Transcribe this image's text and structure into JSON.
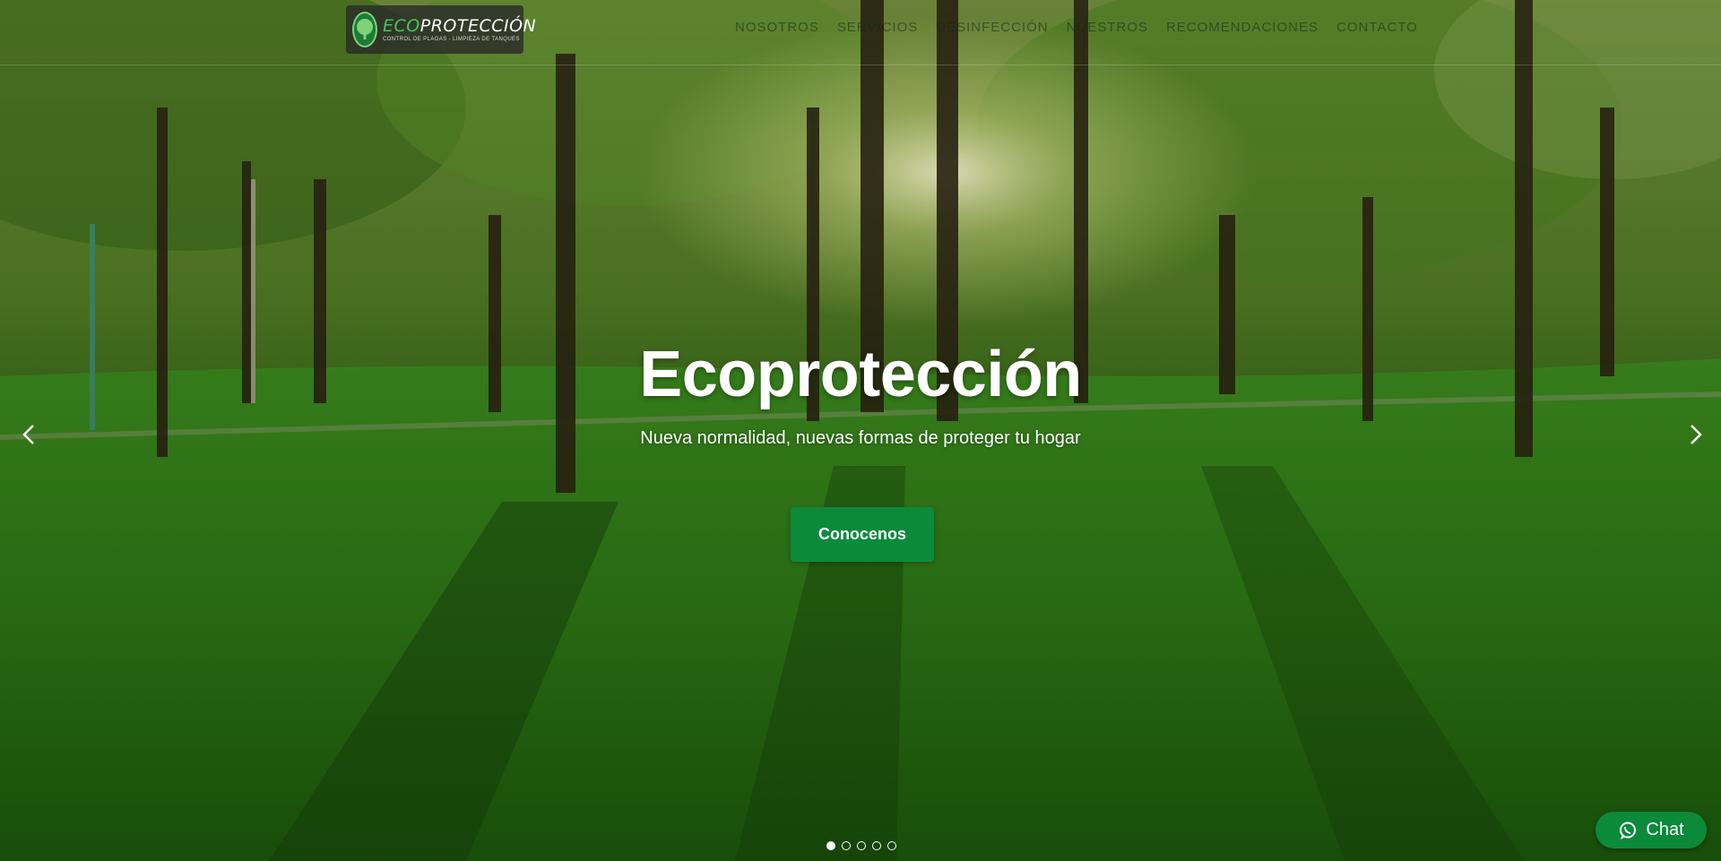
{
  "header": {
    "logo": {
      "title_prefix": "ECO",
      "title_suffix": "PROTECCIÓN",
      "subtitle": "CONTROL DE PLAGAS - LIMPIEZA DE TANQUES"
    },
    "nav": [
      "NOSOTROS",
      "SERVICIOS",
      "DESINFECCIÓN",
      "NUESTROS",
      "RECOMENDACIONES",
      "CONTACTO"
    ]
  },
  "slider": {
    "title": "Ecoprotección",
    "subtitle": "Nueva normalidad, nuevas formas de proteger tu hogar",
    "cta_label": "Conocenos",
    "slide_count": 5,
    "active_index": 0
  },
  "chat": {
    "label": "Chat"
  },
  "colors": {
    "accent": "#0b8a3a",
    "logo_green": "#4cc25a"
  }
}
